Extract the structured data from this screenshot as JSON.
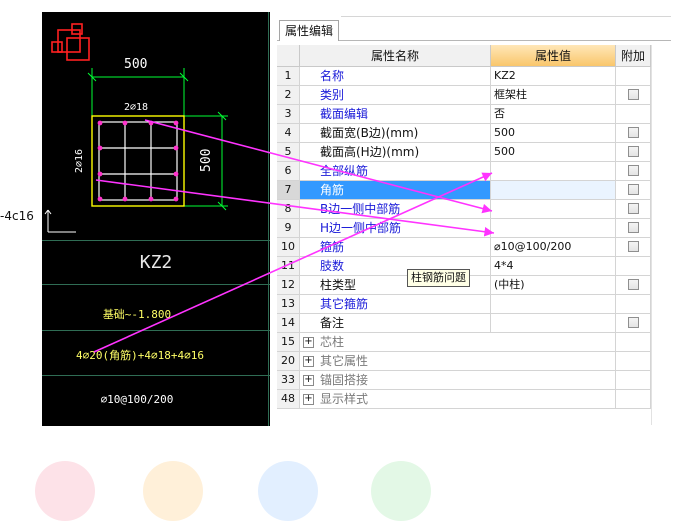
{
  "cad": {
    "side_label": "-4c16",
    "dim_width": "500",
    "dim_height": "500",
    "corner_bar_label": "2⌀18",
    "side_bar_label": "2⌀16",
    "column_name": "KZ2",
    "elevation": "基础~-1.800",
    "longitudinal_bars": "4⌀20(角筋)+4⌀18+4⌀16",
    "stirrups": "⌀10@100/200"
  },
  "panel": {
    "tab_label": "属性编辑",
    "headers": {
      "num": "",
      "name": "属性名称",
      "value": "属性值",
      "add": "附加"
    },
    "rows": [
      {
        "num": "1",
        "name": "名称",
        "value": "KZ2",
        "name_color": "blue",
        "checkbox": false
      },
      {
        "num": "2",
        "name": "类别",
        "value": "框架柱",
        "name_color": "blue",
        "checkbox": true
      },
      {
        "num": "3",
        "name": "截面编辑",
        "value": "否",
        "name_color": "blue",
        "checkbox": false
      },
      {
        "num": "4",
        "name": "截面宽(B边)(mm)",
        "value": "500",
        "name_color": "dark",
        "checkbox": true
      },
      {
        "num": "5",
        "name": "截面高(H边)(mm)",
        "value": "500",
        "name_color": "dark",
        "checkbox": true
      },
      {
        "num": "6",
        "name": "全部纵筋",
        "value": "",
        "name_color": "blue",
        "checkbox": true
      },
      {
        "num": "7",
        "name": "角筋",
        "value": "",
        "name_color": "blue",
        "checkbox": true,
        "selected": true
      },
      {
        "num": "8",
        "name": "B边一侧中部筋",
        "value": "",
        "name_color": "blue",
        "checkbox": true
      },
      {
        "num": "9",
        "name": "H边一侧中部筋",
        "value": "",
        "name_color": "blue",
        "checkbox": true
      },
      {
        "num": "10",
        "name": "箍筋",
        "value": "⌀10@100/200",
        "name_color": "blue",
        "checkbox": true
      },
      {
        "num": "11",
        "name": "肢数",
        "value": "4*4",
        "name_color": "blue",
        "checkbox": false
      },
      {
        "num": "12",
        "name": "柱类型",
        "value": "(中柱)",
        "name_color": "dark",
        "checkbox": true
      },
      {
        "num": "13",
        "name": "其它箍筋",
        "value": "",
        "name_color": "blue",
        "checkbox": false
      },
      {
        "num": "14",
        "name": "备注",
        "value": "",
        "name_color": "dark",
        "checkbox": true
      }
    ],
    "groups": [
      {
        "num": "15",
        "expander": "+",
        "name": "芯柱"
      },
      {
        "num": "20",
        "expander": "+",
        "name": "其它属性"
      },
      {
        "num": "33",
        "expander": "+",
        "name": "锚固搭接"
      },
      {
        "num": "48",
        "expander": "+",
        "name": "显示样式"
      }
    ]
  },
  "tooltip": "柱钢筋问题",
  "colors": {
    "cad_background": "#000000",
    "rebar": "#ff33cc",
    "section_outline": "#ffff00",
    "dimension": "#00ff33",
    "selection": "#3399ff",
    "value_header": "#f9c66b",
    "annotation_arrow": "#ff33ff"
  }
}
